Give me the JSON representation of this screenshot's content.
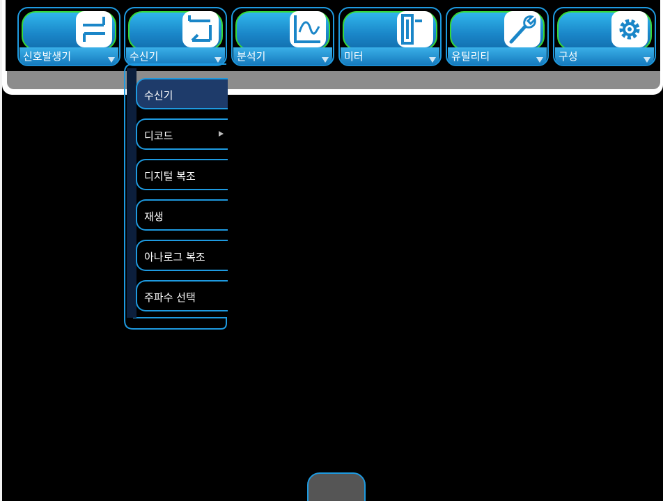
{
  "toolbar": {
    "items": [
      {
        "label": "신호발생기",
        "icon": "signal-generator-icon"
      },
      {
        "label": "수신기",
        "icon": "receiver-icon"
      },
      {
        "label": "분석기",
        "icon": "analyzer-icon"
      },
      {
        "label": "미터",
        "icon": "meter-icon"
      },
      {
        "label": "유틸리티",
        "icon": "wrench-icon"
      },
      {
        "label": "구성",
        "icon": "gear-icon"
      }
    ]
  },
  "dropdown": {
    "items": [
      {
        "label": "수신기"
      },
      {
        "label": "디코드",
        "has_submenu": true
      },
      {
        "label": "디지털 복조"
      },
      {
        "label": "재생"
      },
      {
        "label": "아나로그 복조"
      },
      {
        "label": "주파수 선택"
      }
    ]
  },
  "colors": {
    "accent_border": "#1e9ae0",
    "pill_highlight": "#38d838",
    "button_blue": "#1a86c8"
  }
}
